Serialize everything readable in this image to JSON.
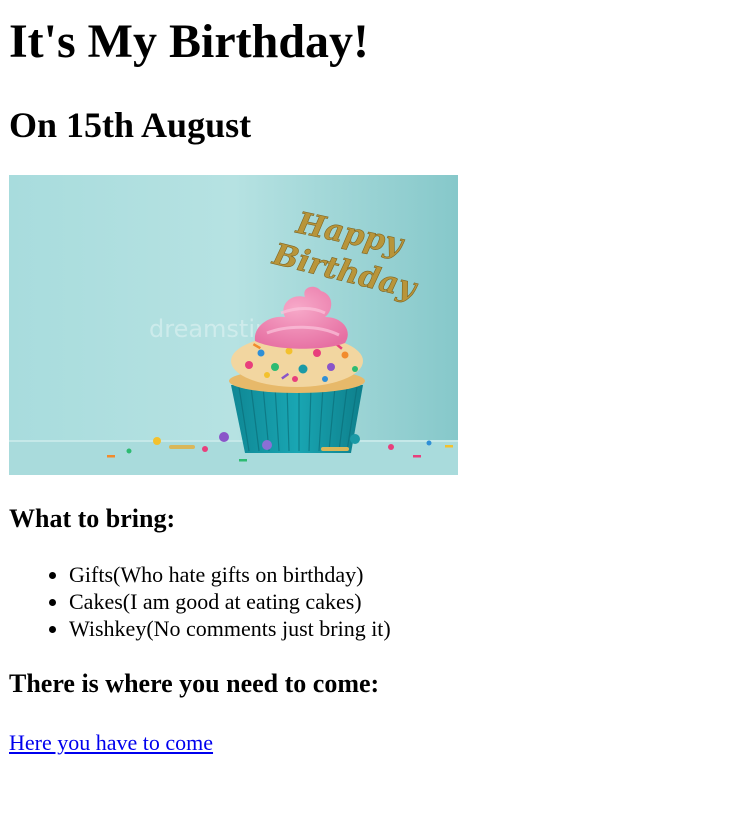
{
  "heading": "It's My Birthday!",
  "subheading": "On 15th August",
  "image": {
    "alt": "Cupcake with Happy Birthday topper",
    "topper_text_1": "Happy",
    "topper_text_2": "Birthday",
    "watermark": "dreamstime"
  },
  "bring": {
    "title": "What to bring:",
    "items": [
      "Gifts(Who hate gifts on birthday)",
      "Cakes(I am good at eating cakes)",
      "Wishkey(No comments just bring it)"
    ]
  },
  "location": {
    "title": "There is where you need to come:",
    "link_text": "Here you have to come"
  },
  "colors": {
    "link": "#0000ee",
    "background_teal": "#9fd6d8",
    "frosting_pink": "#ef7fae",
    "wrapper_teal": "#1496a3"
  }
}
